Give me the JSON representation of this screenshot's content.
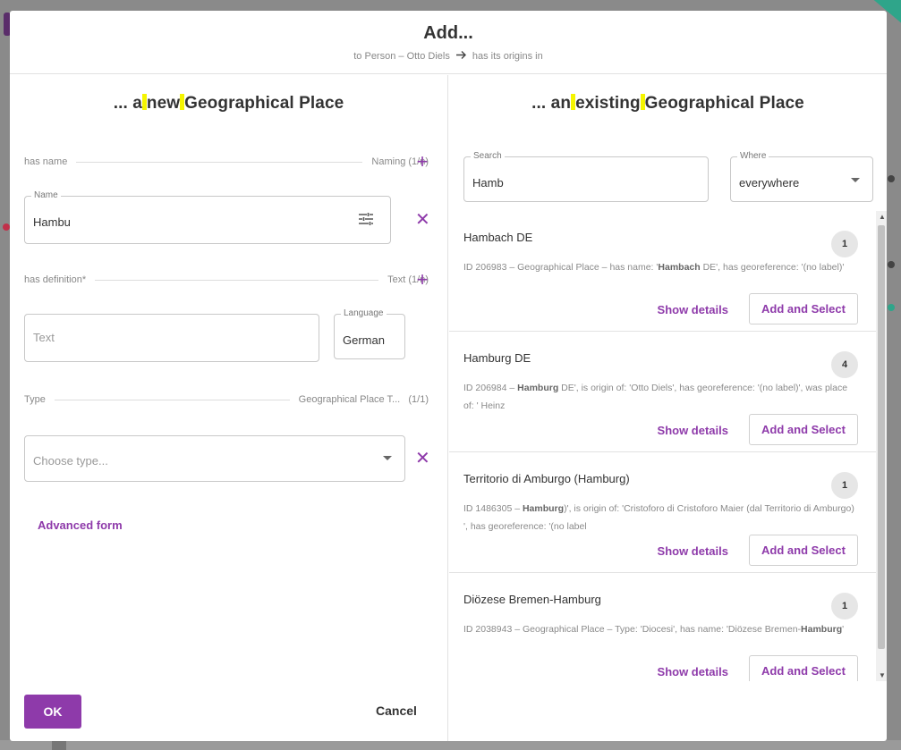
{
  "modal": {
    "title": "Add...",
    "subtitle_source": "to Person – Otto Diels",
    "subtitle_target": "has its origins in"
  },
  "left": {
    "title_parts": [
      "... a",
      "new",
      "Geographical Place"
    ],
    "has_name": {
      "label": "has name",
      "type": "Naming",
      "count": "(1/n)"
    },
    "name_field": {
      "legend": "Name",
      "value": "Hambu"
    },
    "has_definition": {
      "label": "has definition*",
      "type": "Text",
      "count": "(1/n)"
    },
    "text_field": {
      "placeholder": "Text"
    },
    "language_field": {
      "legend": "Language",
      "value": "German"
    },
    "type_row": {
      "label": "Type",
      "type": "Geographical Place T...",
      "count": "(1/1)"
    },
    "type_select": {
      "placeholder": "Choose type..."
    },
    "advanced_form": "Advanced form",
    "ok": "OK",
    "cancel": "Cancel"
  },
  "right": {
    "title_parts": [
      "... an",
      "existing",
      "Geographical Place"
    ],
    "search": {
      "legend": "Search",
      "value": "Hamb"
    },
    "where": {
      "legend": "Where",
      "value": "everywhere"
    },
    "results": [
      {
        "name": "Hambach DE",
        "count": "1",
        "desc_pre": "ID 206983 – Geographical Place – has name: '",
        "desc_bold": "Hambach",
        "desc_post": " DE', has georeference: '(no label)'",
        "show_details": "Show details",
        "add_select": "Add and Select"
      },
      {
        "name": "Hamburg DE",
        "count": "4",
        "desc_pre": "ID 206984 – ",
        "desc_bold": "Hamburg",
        "desc_post": " DE', is origin of: 'Otto Diels', has georeference: '(no label)', was place of: ' Heinz",
        "show_details": "Show details",
        "add_select": "Add and Select"
      },
      {
        "name": "Territorio di Amburgo (Hamburg)",
        "count": "1",
        "desc_pre": "ID 1486305 – ",
        "desc_bold": "Hamburg",
        "desc_post": ")', is origin of: 'Cristoforo di Cristoforo Maier (dal Territorio di Amburgo) ', has georeference: '(no label",
        "show_details": "Show details",
        "add_select": "Add and Select"
      },
      {
        "name": "Diözese Bremen-Hamburg",
        "count": "1",
        "desc_pre": "ID 2038943 – Geographical Place – Type: 'Diocesi', has name: 'Diözese Bremen-",
        "desc_bold": "Hamburg",
        "desc_post": "'",
        "show_details": "Show details",
        "add_select": "Add and Select"
      }
    ]
  },
  "colors": {
    "accent": "#8e3aaa",
    "highlight": "#f5f500"
  },
  "icons": [
    "arrow-right-icon",
    "plus-icon",
    "close-icon",
    "tune-icon",
    "chevron-down-icon",
    "scroll-up-icon",
    "scroll-down-icon"
  ]
}
